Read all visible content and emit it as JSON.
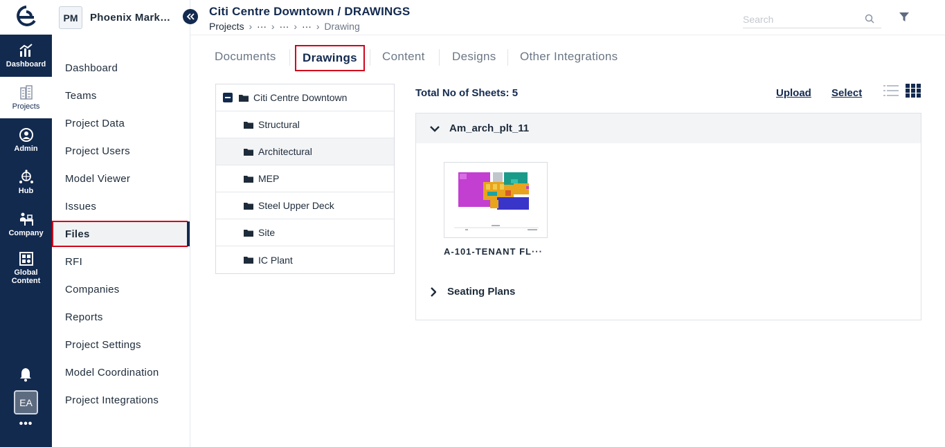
{
  "rail": {
    "logo_icon": "e-logo-icon",
    "items": [
      {
        "label": "Dashboard",
        "icon": "bar-chart-icon",
        "active": false
      },
      {
        "label": "Projects",
        "icon": "buildings-icon",
        "active": true
      },
      {
        "label": "Admin",
        "icon": "user-gear-icon",
        "active": false
      },
      {
        "label": "Hub",
        "icon": "globe-hub-icon",
        "active": false
      },
      {
        "label": "Company",
        "icon": "desk-icon",
        "active": false
      },
      {
        "label": "Global\nContent",
        "icon": "grid-content-icon",
        "active": false
      }
    ],
    "avatar": "EA",
    "more": "•••"
  },
  "project": {
    "initials": "PM",
    "name": "Phoenix Mark…"
  },
  "sidebar": {
    "items": [
      {
        "label": "Dashboard"
      },
      {
        "label": "Teams"
      },
      {
        "label": "Project Data"
      },
      {
        "label": "Project Users"
      },
      {
        "label": "Model Viewer"
      },
      {
        "label": "Issues"
      },
      {
        "label": "Files",
        "active": true
      },
      {
        "label": "RFI"
      },
      {
        "label": "Companies"
      },
      {
        "label": "Reports"
      },
      {
        "label": "Project Settings"
      },
      {
        "label": "Model Coordination"
      },
      {
        "label": "Project Integrations"
      }
    ]
  },
  "header": {
    "title": "Citi Centre Downtown / DRAWINGS",
    "breadcrumb": {
      "root": "Projects",
      "ellipsis": [
        "···",
        "···",
        "···"
      ],
      "current": "Drawing",
      "separator": "›"
    },
    "search_placeholder": "Search"
  },
  "tabs": [
    {
      "label": "Documents",
      "active": false
    },
    {
      "label": "Drawings",
      "active": true
    },
    {
      "label": "Content",
      "active": false
    },
    {
      "label": "Designs",
      "active": false
    },
    {
      "label": "Other Integrations",
      "active": false
    }
  ],
  "tree": {
    "root": "Citi Centre Downtown",
    "children": [
      {
        "label": "Structural",
        "selected": false
      },
      {
        "label": "Architectural",
        "selected": true
      },
      {
        "label": "MEP",
        "selected": false
      },
      {
        "label": "Steel Upper Deck",
        "selected": false
      },
      {
        "label": "Site",
        "selected": false
      },
      {
        "label": "IC Plant",
        "selected": false
      }
    ]
  },
  "sheets": {
    "total_label": "Total No of Sheets: 5",
    "upload_label": "Upload",
    "select_label": "Select",
    "groups": [
      {
        "name": "Am_arch_plt_11",
        "expanded": true,
        "items": [
          {
            "label": "A-101-TENANT FL···"
          }
        ]
      },
      {
        "name": "Seating Plans",
        "expanded": false
      }
    ]
  },
  "colors": {
    "navy": "#132a4f",
    "highlight_red": "#d0021b",
    "muted_text": "#6b7785"
  }
}
